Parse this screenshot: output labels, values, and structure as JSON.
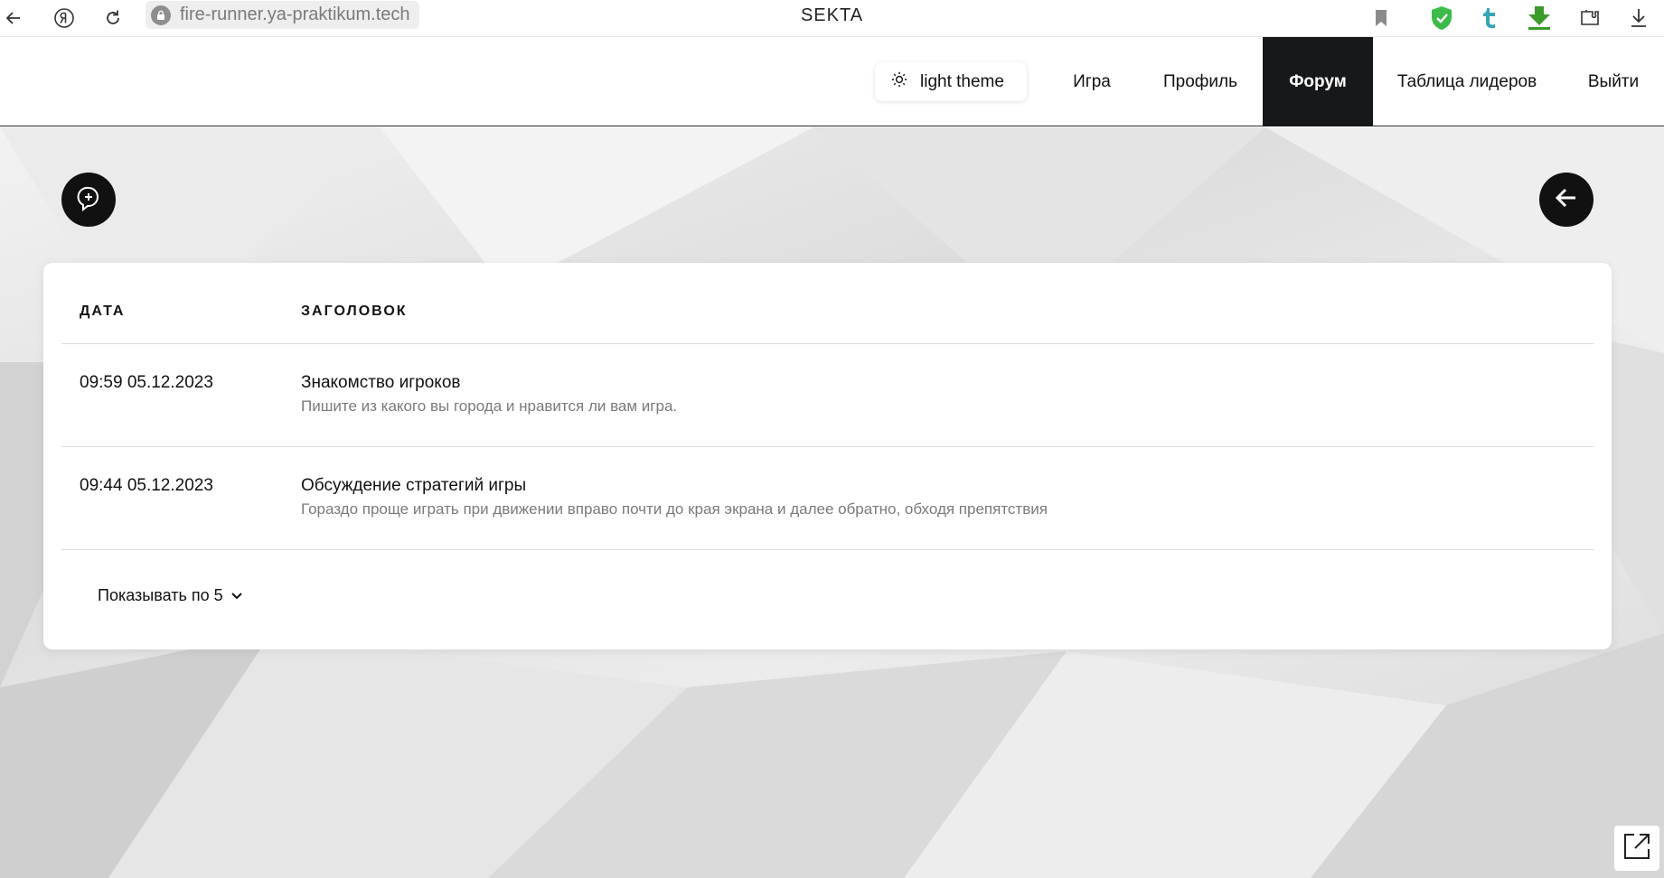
{
  "browser": {
    "url": "fire-runner.ya-praktikum.tech",
    "page_name": "SEKTA",
    "icons": [
      "back-arrow-icon",
      "yandex-icon",
      "reload-icon",
      "lock-icon",
      "bookmark-icon",
      "shield-check-icon",
      "tumblr-icon",
      "download-arrow-green-icon",
      "extensions-icon",
      "download-icon"
    ],
    "colors": {
      "shield": "#3dbb4a",
      "tumblr": "#34a6b6",
      "download_green": "#3a9a2a"
    }
  },
  "header": {
    "theme_toggle_label": "light theme",
    "nav": [
      {
        "label": "Игра",
        "active": false
      },
      {
        "label": "Профиль",
        "active": false
      },
      {
        "label": "Форум",
        "active": true
      },
      {
        "label": "Таблица лидеров",
        "active": false
      },
      {
        "label": "Выйти",
        "active": false
      }
    ]
  },
  "forum": {
    "columns": {
      "date": "ДАТА",
      "title": "ЗАГОЛОВОК"
    },
    "topics": [
      {
        "date": "09:59 05.12.2023",
        "title": "Знакомство игроков",
        "description": "Пишите из какого вы города и нравится ли вам игра."
      },
      {
        "date": "09:44 05.12.2023",
        "title": "Обсуждение стратегий игры",
        "description": "Гораздо проще играть при движении вправо почти до края экрана и далее обратно, обходя препятствия"
      }
    ],
    "page_size_label": "Показывать по 5",
    "new_topic_icon": "add-comment-icon",
    "back_icon": "arrow-left-icon"
  },
  "accent": {
    "dark": "#16181a",
    "muted_text": "#7a7a7a"
  }
}
